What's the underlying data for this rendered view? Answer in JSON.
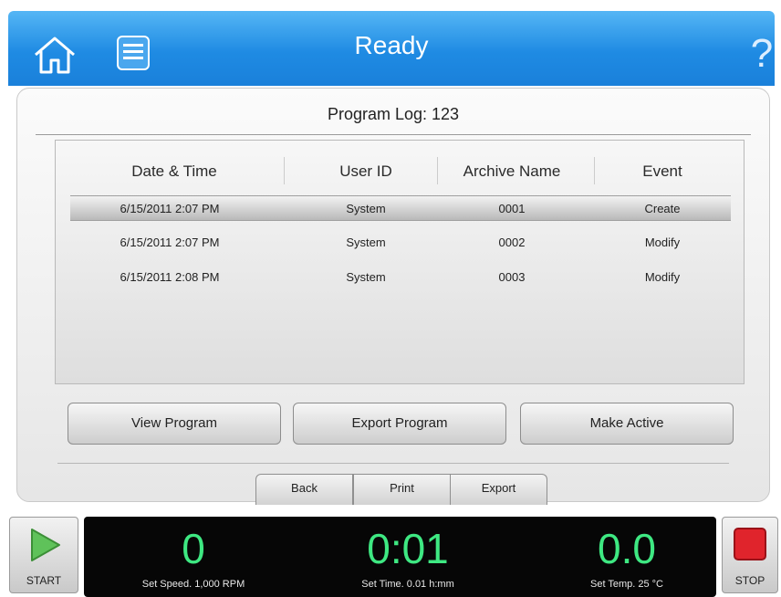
{
  "header": {
    "title": "Ready",
    "home_icon": "home-icon",
    "menu_icon": "list-icon",
    "help_label": "?"
  },
  "panel": {
    "title": "Program Log: 123",
    "columns": [
      "Date & Time",
      "User ID",
      "Archive Name",
      "Event"
    ],
    "rows": [
      {
        "date_time": "6/15/2011 2:07 PM",
        "user_id": "System",
        "archive_name": "0001",
        "event": "Create",
        "selected": true
      },
      {
        "date_time": "6/15/2011 2:07 PM",
        "user_id": "System",
        "archive_name": "0002",
        "event": "Modify",
        "selected": false
      },
      {
        "date_time": "6/15/2011 2:08 PM",
        "user_id": "System",
        "archive_name": "0003",
        "event": "Modify",
        "selected": false
      }
    ],
    "actions": {
      "view_program": "View Program",
      "export_program": "Export Program",
      "make_active": "Make Active"
    },
    "tabs": {
      "back": "Back",
      "print": "Print",
      "export": "Export"
    }
  },
  "footer": {
    "start_label": "START",
    "stop_label": "STOP",
    "speed_value": "0",
    "speed_set": "Set Speed. 1,000 RPM",
    "time_value": "0:01",
    "time_set": "Set Time. 0.01 h:mm",
    "temp_value": "0.0",
    "temp_set": "Set Temp. 25 °C"
  },
  "colors": {
    "header_blue": "#1f8be3",
    "readout_green": "#3ee882",
    "stop_red": "#e0242c",
    "start_green": "#5fc25a"
  }
}
